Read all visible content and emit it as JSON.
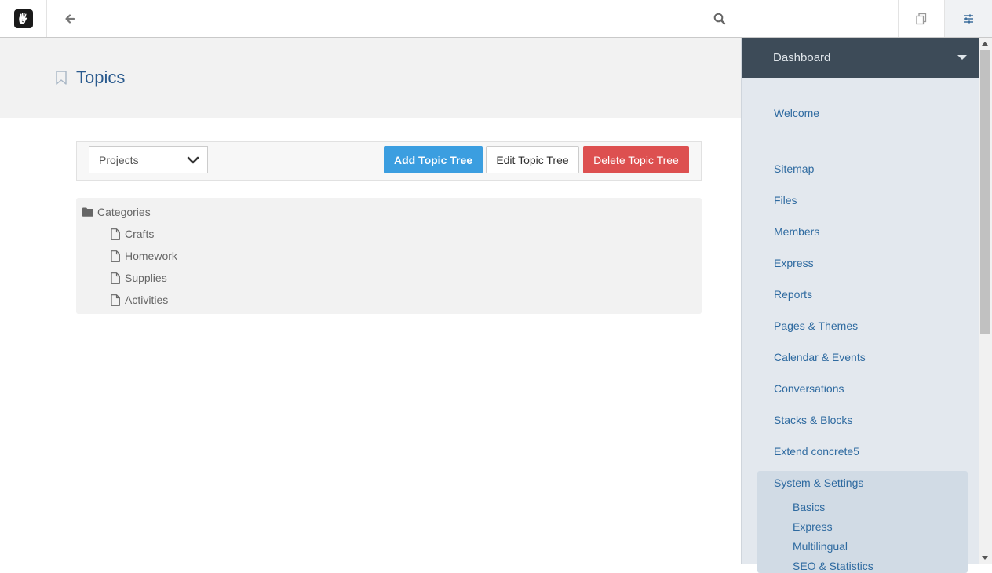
{
  "toolbar": {
    "logo_icon": "concrete5-hand-logo",
    "back_icon": "arrow-left-icon",
    "search_icon": "search-icon",
    "search_value": "",
    "intelligent_search_icon": "copy-pages-icon",
    "settings_icon": "sliders-icon"
  },
  "page": {
    "title": "Topics",
    "bookmark_icon": "bookmark-icon"
  },
  "controls": {
    "selected_tree": "Projects",
    "add_label": "Add Topic Tree",
    "edit_label": "Edit Topic Tree",
    "delete_label": "Delete Topic Tree"
  },
  "tree": {
    "root": "Categories",
    "children": [
      "Crafts",
      "Homework",
      "Supplies",
      "Activities"
    ]
  },
  "dashboard": {
    "title": "Dashboard",
    "welcome": "Welcome",
    "items": [
      "Sitemap",
      "Files",
      "Members",
      "Express",
      "Reports",
      "Pages & Themes",
      "Calendar & Events",
      "Conversations",
      "Stacks & Blocks",
      "Extend concrete5",
      "System & Settings"
    ],
    "sub_items": [
      "Basics",
      "Express",
      "Multilingual",
      "SEO & Statistics"
    ]
  },
  "colors": {
    "primary": "#3b9ee0",
    "danger": "#dd5050",
    "title_blue": "#2a5a8e",
    "panel_header": "#3d4b58"
  }
}
